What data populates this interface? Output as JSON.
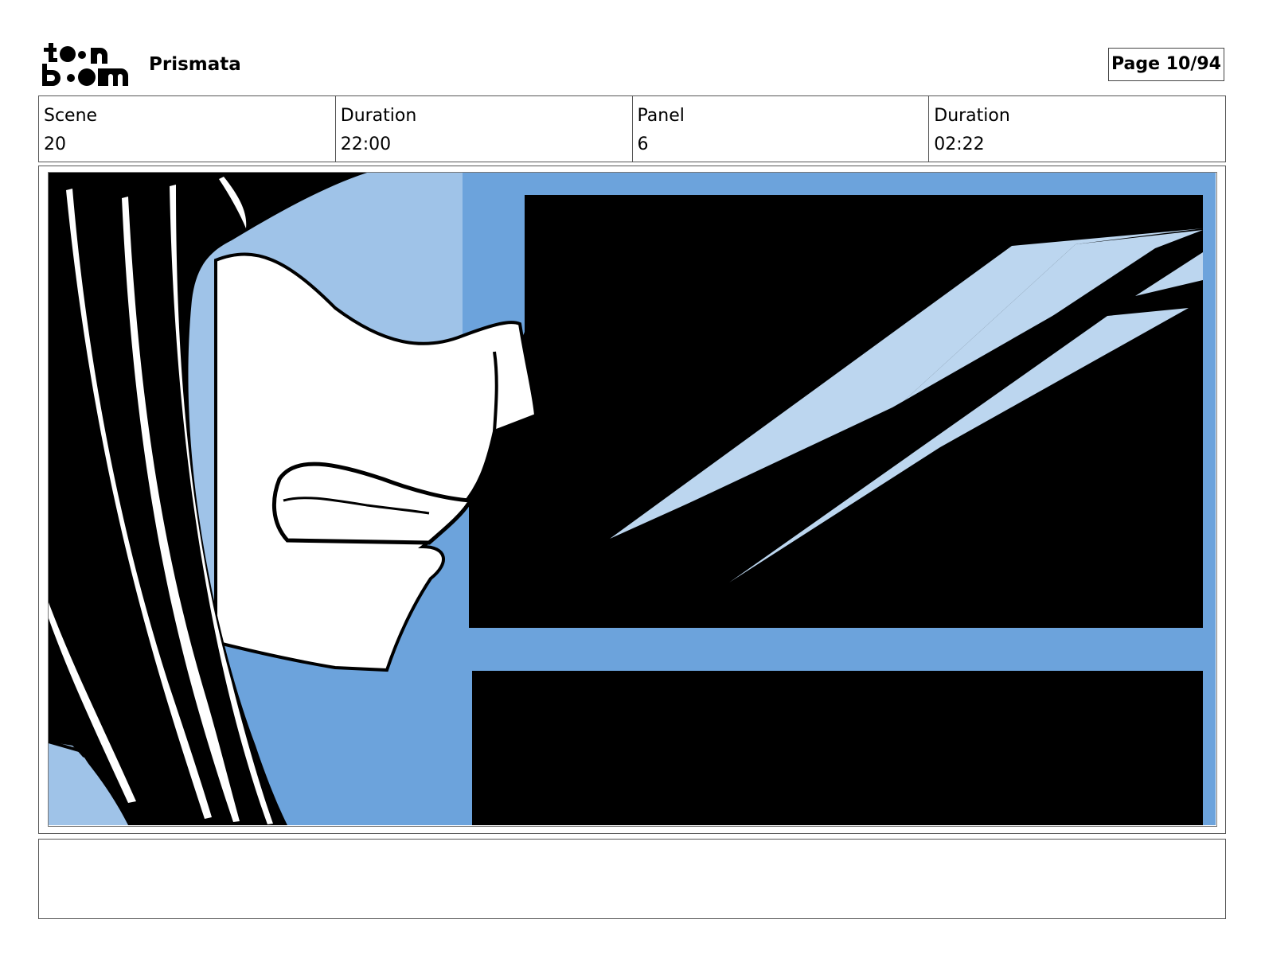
{
  "header": {
    "logo_text": "toon boom",
    "project_title": "Prismata",
    "page_label": "Page 10/94"
  },
  "info": {
    "scene_label": "Scene",
    "scene_value": "20",
    "scene_duration_label": "Duration",
    "scene_duration_value": "22:00",
    "panel_label": "Panel",
    "panel_value": "6",
    "panel_duration_label": "Duration",
    "panel_duration_value": "02:22"
  },
  "colors": {
    "sky_light": "#9fc3e8",
    "sky_mid": "#6ca3dc",
    "slash_light": "#bcd6ef",
    "ink": "#000000"
  },
  "notes": {
    "text": ""
  }
}
